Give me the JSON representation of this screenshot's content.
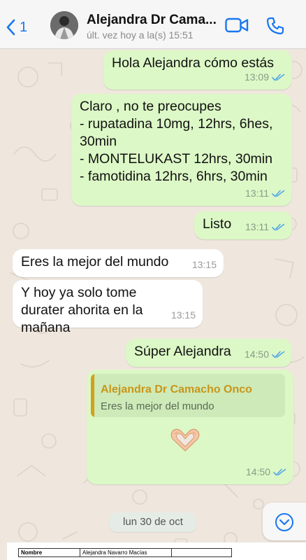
{
  "header": {
    "back_count": "1",
    "contact_name": "Alejandra  Dr Cama...",
    "status": "últ. vez hoy a la(s) 15:51"
  },
  "messages": [
    {
      "text": "Hola Alejandra cómo estás",
      "time": "13:09",
      "direction": "out",
      "read": true
    },
    {
      "text": "Claro , no te preocupes\n- rupatadina 10mg, 12hrs, 6hes, 30min\n- MONTELUKAST 12hrs, 30min\n- famotidina 12hrs, 6hrs, 30min",
      "time": "13:11",
      "direction": "out",
      "read": true
    },
    {
      "text": "Listo",
      "time": "13:11",
      "direction": "out",
      "read": true
    },
    {
      "text": "Eres la mejor del mundo",
      "time": "13:15",
      "direction": "in"
    },
    {
      "text": "Y hoy ya solo tome durater ahorita en la mañana",
      "time": "13:15",
      "direction": "in"
    },
    {
      "text": "Súper Alejandra",
      "time": "14:50",
      "direction": "out",
      "read": true
    },
    {
      "quote_author": "Alejandra  Dr Camacho Onco",
      "quote_text": "Eres la mejor del mundo",
      "text": "",
      "emoji": "heart-hands-icon",
      "time": "14:50",
      "direction": "out",
      "read": true
    }
  ],
  "date_separator": "lun 30 de oct",
  "document_preview": {
    "rows": [
      {
        "label": "Nombre",
        "value": "Alejandra Navarro Macías"
      }
    ]
  },
  "colors": {
    "outgoing_bubble": "#dcf8c6",
    "incoming_bubble": "#ffffff",
    "accent": "#1877f2",
    "read_tick": "#53a6e6",
    "quote_author": "#c8961a",
    "background": "#efe7de"
  }
}
